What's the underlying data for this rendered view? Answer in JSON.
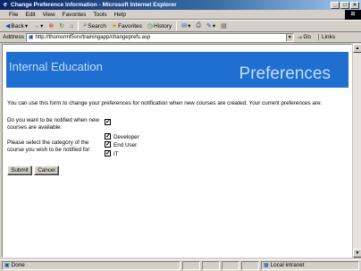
{
  "window": {
    "title": "Change Preference Information - Microsoft Internet Explorer"
  },
  "menu": [
    "File",
    "Edit",
    "View",
    "Favorites",
    "Tools",
    "Help"
  ],
  "toolbar": {
    "back": "Back",
    "forward_icon": "→",
    "search": "Search",
    "favorites": "Favorites",
    "history": "History"
  },
  "address": {
    "label": "Address",
    "url": "http://thomsrmf5srv/trainingapp/changeprefs.asp",
    "go": "Go",
    "links": "Links"
  },
  "page": {
    "banner_left": "Internal Education",
    "banner_right": "Preferences",
    "intro": "You can use this form to change your preferences for notification when new courses are created. Your current preferences are:",
    "notify_question": "Do you want to be notified when new courses are available:",
    "notify_checked": true,
    "category_question": "Please select the category of the course you wish to be notified for:",
    "categories": [
      {
        "label": "Developer",
        "checked": true
      },
      {
        "label": "End User",
        "checked": true
      },
      {
        "label": "IT",
        "checked": true
      }
    ],
    "submit": "Submit",
    "cancel": "Cancel"
  },
  "status": {
    "left": "Done",
    "zone": "Local intranet"
  }
}
